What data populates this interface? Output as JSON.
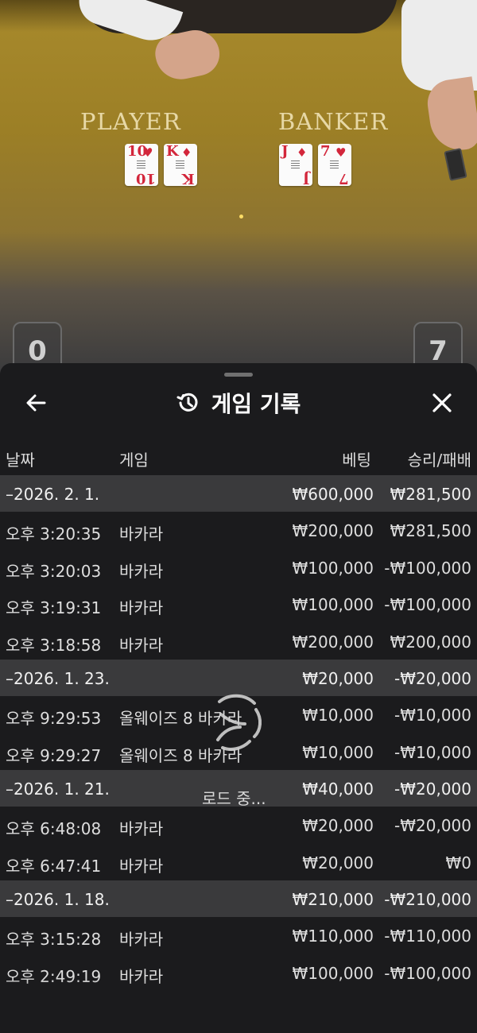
{
  "video": {
    "player_label": "PLAYER",
    "banker_label": "BANKER",
    "player_cards": [
      {
        "rank": "10",
        "suit": "♥"
      },
      {
        "rank": "K",
        "suit": "♦"
      }
    ],
    "banker_cards": [
      {
        "rank": "J",
        "suit": "♦"
      },
      {
        "rank": "7",
        "suit": "♥"
      }
    ],
    "player_score": "0",
    "banker_score": "7"
  },
  "sheet": {
    "title": "게임 기록",
    "icons": {
      "back": "arrow-left-icon",
      "close": "close-icon",
      "title": "history-icon"
    },
    "columns": {
      "date": "날짜",
      "game": "게임",
      "bet": "베팅",
      "result": "승리/패배"
    },
    "groups": [
      {
        "date": "–2026. 2. 1.",
        "bet": "₩600,000",
        "result": "₩281,500",
        "rows": [
          {
            "time": "오후 3:20:35",
            "game": "바카라",
            "bet": "₩200,000",
            "result": "₩281,500"
          },
          {
            "time": "오후 3:20:03",
            "game": "바카라",
            "bet": "₩100,000",
            "result": "-₩100,000"
          },
          {
            "time": "오후 3:19:31",
            "game": "바카라",
            "bet": "₩100,000",
            "result": "-₩100,000"
          },
          {
            "time": "오후 3:18:58",
            "game": "바카라",
            "bet": "₩200,000",
            "result": "₩200,000"
          }
        ]
      },
      {
        "date": "–2026. 1. 23.",
        "bet": "₩20,000",
        "result": "-₩20,000",
        "rows": [
          {
            "time": "오후 9:29:53",
            "game": "올웨이즈 8 바카라",
            "bet": "₩10,000",
            "result": "-₩10,000"
          },
          {
            "time": "오후 9:29:27",
            "game": "올웨이즈 8 바카라",
            "bet": "₩10,000",
            "result": "-₩10,000"
          }
        ]
      },
      {
        "date": "–2026. 1. 21.",
        "bet": "₩40,000",
        "result": "-₩20,000",
        "rows": [
          {
            "time": "오후 6:48:08",
            "game": "바카라",
            "bet": "₩20,000",
            "result": "-₩20,000"
          },
          {
            "time": "오후 6:47:41",
            "game": "바카라",
            "bet": "₩20,000",
            "result": "₩0"
          }
        ]
      },
      {
        "date": "–2026. 1. 18.",
        "bet": "₩210,000",
        "result": "-₩210,000",
        "rows": [
          {
            "time": "오후 3:15:28",
            "game": "바카라",
            "bet": "₩110,000",
            "result": "-₩110,000"
          },
          {
            "time": "오후 2:49:19",
            "game": "바카라",
            "bet": "₩100,000",
            "result": "-₩100,000"
          }
        ]
      }
    ],
    "loading_text": "로드 중..."
  }
}
